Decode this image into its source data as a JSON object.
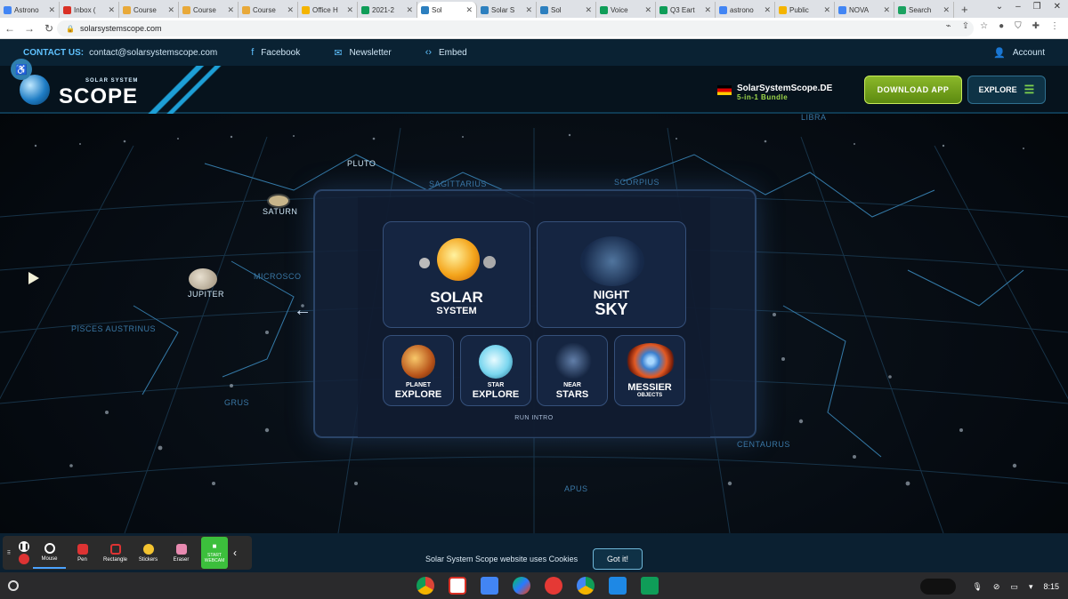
{
  "browser": {
    "tabs": [
      {
        "label": "Astrono",
        "color": "#4285f4"
      },
      {
        "label": "Inbox (",
        "color": "#d93025"
      },
      {
        "label": "Course",
        "color": "#e8a93a"
      },
      {
        "label": "Course",
        "color": "#e8a93a"
      },
      {
        "label": "Course",
        "color": "#e8a93a"
      },
      {
        "label": "Office H",
        "color": "#f4b400"
      },
      {
        "label": "2021-2",
        "color": "#0f9d58"
      },
      {
        "label": "Sol",
        "color": "#2c7fbf",
        "active": true
      },
      {
        "label": "Solar S",
        "color": "#2c7fbf"
      },
      {
        "label": "Sol",
        "color": "#2c7fbf"
      },
      {
        "label": "Voice",
        "color": "#0f9d58"
      },
      {
        "label": "Q3 Eart",
        "color": "#0f9d58"
      },
      {
        "label": "astrono",
        "color": "#4285f4"
      },
      {
        "label": "Public",
        "color": "#f4b400"
      },
      {
        "label": "NOVA",
        "color": "#4285f4"
      },
      {
        "label": "Search",
        "color": "#1aa260"
      }
    ],
    "url": "solarsystemscope.com"
  },
  "site": {
    "contact_label": "CONTACT US:",
    "contact_email": "contact@solarsystemscope.com",
    "facebook": "Facebook",
    "newsletter": "Newsletter",
    "embed": "Embed",
    "account": "Account",
    "logo_small": "SOLAR SYSTEM",
    "logo_big": "SCOPE",
    "de_title": "SolarSystemScope.DE",
    "de_sub": "5-in-1 Bundle",
    "download": "DOWNLOAD APP",
    "explore": "EXPLORE"
  },
  "labels": {
    "libra": "LIBRA",
    "pluto": "PLUTO",
    "sagittarius": "SAGITTARIUS",
    "scorpius": "SCORPIUS",
    "saturn": "SATURN",
    "jupiter": "JUPITER",
    "microscopium": "MICROSCO",
    "pisces": "PISCES AUSTRINUS",
    "grus": "GRUS",
    "centaurus": "CENTAURUS",
    "apus": "APUS"
  },
  "menu": {
    "solar_1": "SOLAR",
    "solar_2": "SYSTEM",
    "night_1": "NIGHT",
    "night_2": "SKY",
    "planet_1": "PLANET",
    "planet_2": "EXPLORE",
    "star_1": "STAR",
    "star_2": "EXPLORE",
    "near_1": "NEAR",
    "near_2": "STARS",
    "messier_1": "MESSIER",
    "messier_2": "OBJECTS",
    "run_intro": "RUN INTRO"
  },
  "toolbar": {
    "mouse": "Mouse",
    "pen": "Pen",
    "rectangle": "Rectangle",
    "stickers": "Stickers",
    "eraser": "Eraser",
    "webcam": "START WEBCAM"
  },
  "cookie": {
    "message": "Solar System Scope website uses Cookies",
    "button": "Got it!"
  },
  "shelf": {
    "time": "8:15"
  }
}
